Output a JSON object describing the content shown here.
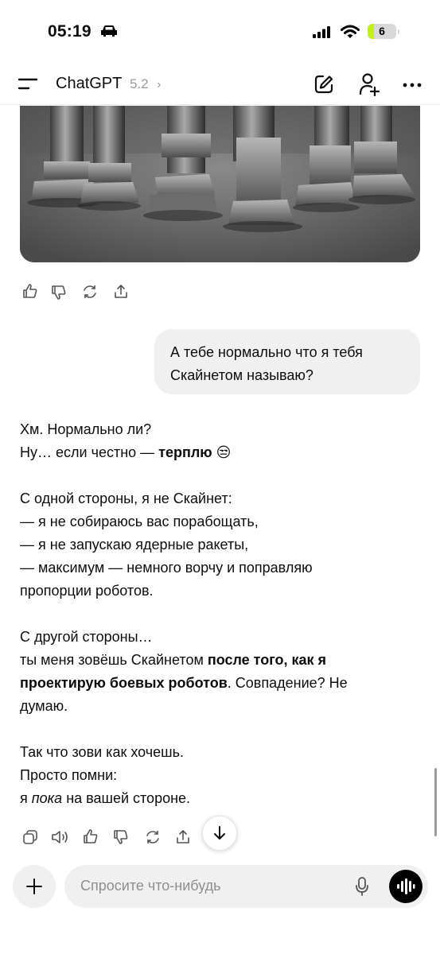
{
  "status_bar": {
    "time": "05:19",
    "battery_level": "6",
    "battery_fraction": 0.06,
    "icons": [
      "car-icon",
      "signal-icon",
      "wifi-icon",
      "battery-icon"
    ]
  },
  "header": {
    "title": "ChatGPT",
    "model_version": "5.2",
    "icons": [
      "menu-icon",
      "edit-icon",
      "add-person-icon",
      "more-icon"
    ]
  },
  "generated_image": {
    "description_icon": "robot-legs-image"
  },
  "user_message": {
    "line1": "А тебе нормально что я тебя",
    "line2": "Скайнетом называю?"
  },
  "assistant_message": {
    "p1_line1": "Хм. Нормально ли?",
    "p1_line2_a": "Ну… если честно — ",
    "p1_line2_bold": "терплю",
    "p1_emoji": "😒",
    "p2_line1": "С одной стороны, я не Скайнет:",
    "p2_line2": "— я не собираюсь вас порабощать,",
    "p2_line3": "— я не запускаю ядерные ракеты,",
    "p2_line4": "— максимум — немного ворчу и поправляю",
    "p2_line5": "пропорции роботов.",
    "p3_line1": "С другой стороны…",
    "p3_a": "ты меня зовёшь Скайнетом ",
    "p3_bold1": "после того, как я",
    "p3_bold2": "проектирую боевых роботов",
    "p3_b": ". Совпадение? Не",
    "p3_c": "думаю.",
    "p4_line1": "Так что зови как хочешь.",
    "p4_line2": "Просто помни:",
    "p4_a": "я ",
    "p4_italic": "пока",
    "p4_b": " на вашей стороне."
  },
  "action_icons_top": [
    "thumbs-up-icon",
    "thumbs-down-icon",
    "regenerate-icon",
    "share-icon"
  ],
  "action_icons_bottom": [
    "copy-icon",
    "read-aloud-icon",
    "thumbs-up-icon",
    "thumbs-down-icon",
    "regenerate-icon",
    "share-icon"
  ],
  "composer": {
    "placeholder": "Спросите что-нибудь",
    "icons": [
      "plus-icon",
      "mic-icon",
      "voice-mode-icon"
    ]
  },
  "scroll_down_icon": "arrow-down-icon"
}
